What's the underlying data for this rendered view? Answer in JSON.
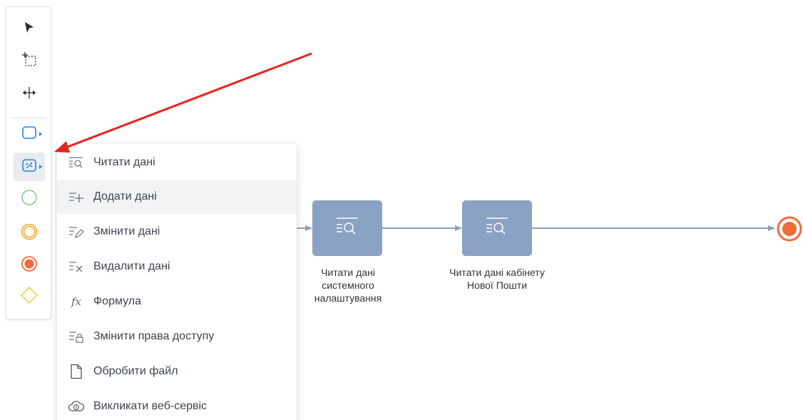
{
  "toolbar": {
    "tools": [
      {
        "icon": "pointer-arrow-icon"
      },
      {
        "icon": "lasso-select-icon"
      },
      {
        "icon": "space-tool-icon"
      },
      {
        "icon": "task-shape-icon"
      },
      {
        "icon": "data-task-shape-icon"
      },
      {
        "icon": "start-event-icon"
      },
      {
        "icon": "intermediate-event-icon"
      },
      {
        "icon": "end-event-icon"
      },
      {
        "icon": "gateway-icon"
      }
    ]
  },
  "menu": {
    "items": [
      {
        "label": "Читати дані",
        "icon": "read-data-icon"
      },
      {
        "label": "Додати дані",
        "icon": "add-data-icon"
      },
      {
        "label": "Змінити дані",
        "icon": "edit-data-icon"
      },
      {
        "label": "Видалити дані",
        "icon": "delete-data-icon"
      },
      {
        "label": "Формула",
        "icon": "formula-icon",
        "glyph": "fx"
      },
      {
        "label": "Змінити права доступу",
        "icon": "access-rights-icon"
      },
      {
        "label": "Обробити файл",
        "icon": "file-icon"
      },
      {
        "label": "Викликати веб-сервіс",
        "icon": "web-service-icon"
      }
    ]
  },
  "canvas": {
    "tasks": [
      {
        "label": "Читати дані\nсистемного\nналаштування",
        "icon": "read-data-icon"
      },
      {
        "label": "Читати дані кабінету\nНової Пошти",
        "icon": "read-data-icon"
      }
    ]
  },
  "colors": {
    "task_fill": "#8aa2c3",
    "accent_blue": "#1e88e5",
    "start_green": "#7cc47f",
    "intermediate_orange": "#f5a623",
    "end_red": "#f26b3a",
    "gateway_yellow": "#f6c23e",
    "annotation_arrow": "#e8231f",
    "connector": "#8ea0b8"
  }
}
